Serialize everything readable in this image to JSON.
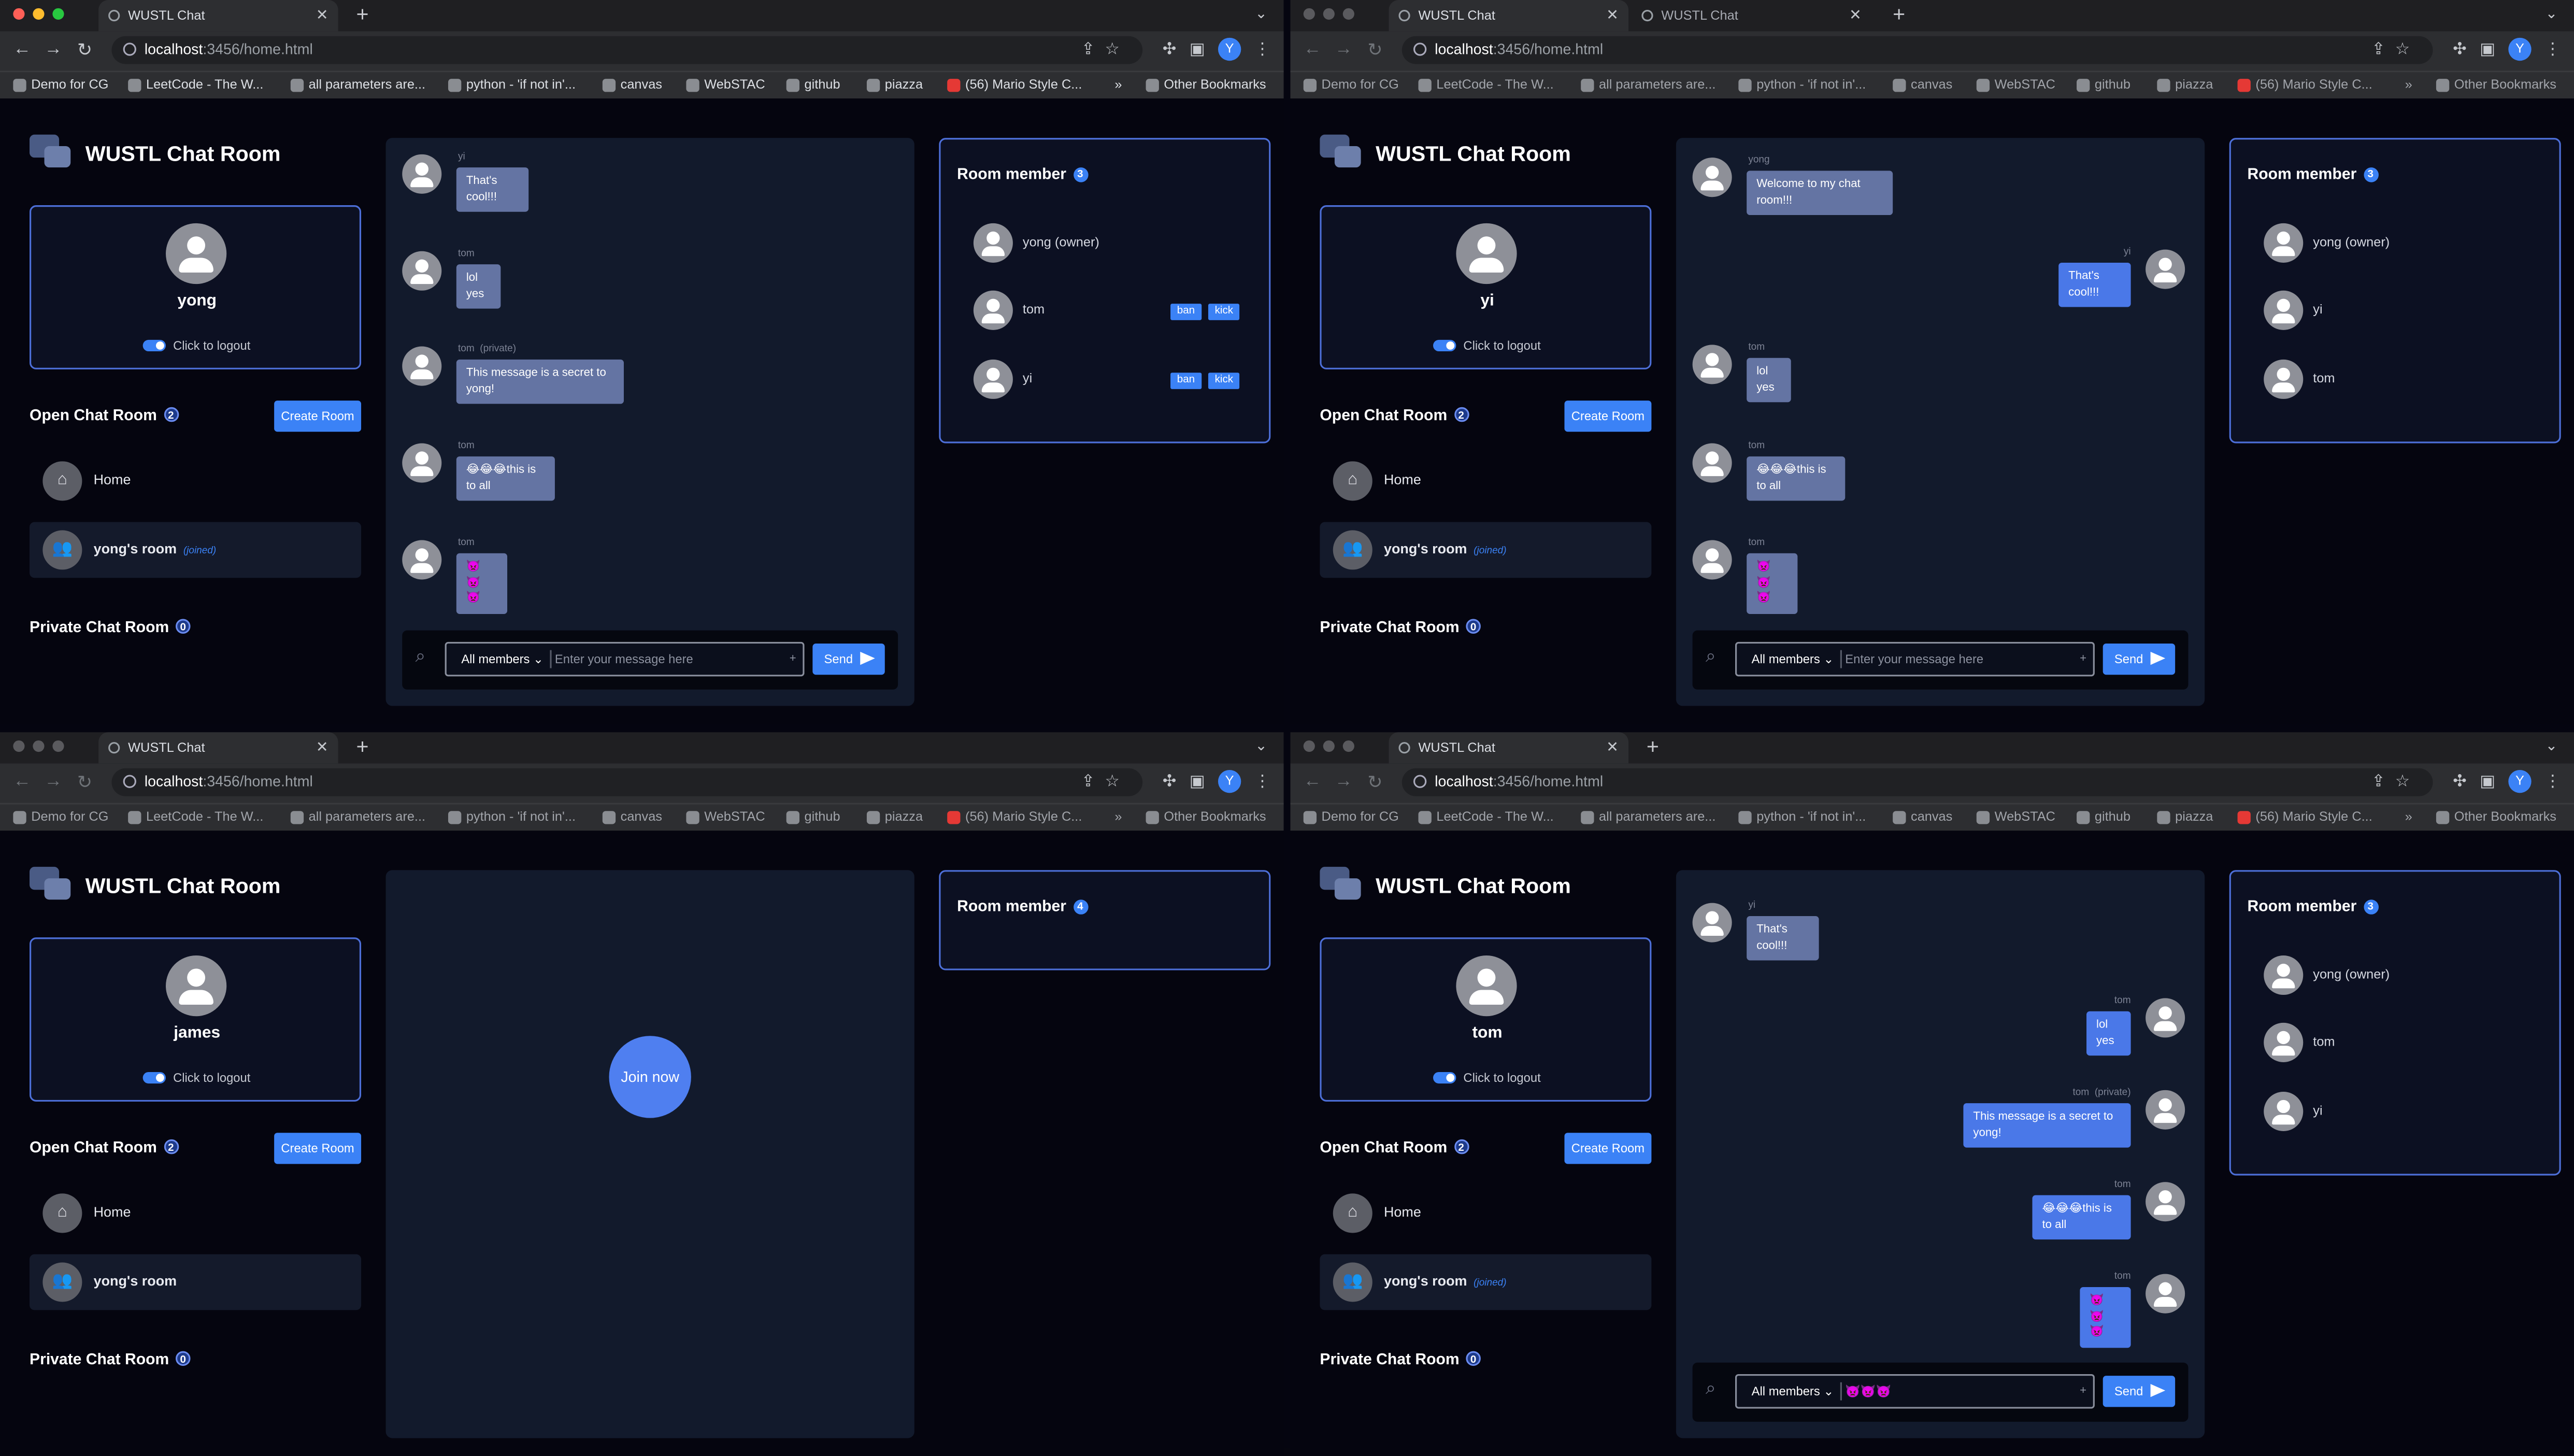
{
  "browser": {
    "tab_title": "WUSTL Chat",
    "url_host": "localhost",
    "url_path": ":3456/home.html",
    "profile_initial": "Y",
    "bookmarks": [
      "Demo for CG",
      "LeetCode - The W...",
      "all parameters are...",
      "python - 'if not in'...",
      "canvas",
      "WebSTAC",
      "github",
      "piazza",
      "(56) Mario Style C...",
      "Other Bookmarks"
    ],
    "bookmarks_more": "»"
  },
  "app": {
    "title": "WUSTL Chat Room",
    "logout_label": "Click to logout",
    "open_rooms_label": "Open Chat Room",
    "open_rooms_count": "2",
    "create_room_label": "Create Room",
    "private_rooms_label": "Private Chat Room",
    "private_rooms_count": "0",
    "rooms": [
      "Home",
      "yong's room"
    ],
    "joined_tag": "(joined)",
    "members_label": "Room member",
    "select_label": "All members",
    "placeholder": "Enter your message here",
    "send_label": "Send",
    "join_label": "Join now",
    "ban_label": "ban",
    "kick_label": "kick"
  },
  "windows": [
    {
      "user": "yong",
      "member_count": "3",
      "members": [
        "yong (owner)",
        "tom",
        "yi"
      ],
      "messages": [
        {
          "who": "yi",
          "text": "That's cool!!!"
        },
        {
          "who": "tom",
          "text": "lol yes"
        },
        {
          "who": "tom",
          "private": "(private)",
          "text": "This message is a secret to yong!"
        },
        {
          "who": "tom",
          "text": "😂😂😂this is to all"
        },
        {
          "who": "tom",
          "text": "👿👿👿"
        }
      ]
    },
    {
      "user": "yi",
      "member_count": "3",
      "members": [
        "yong (owner)",
        "yi",
        "tom"
      ],
      "messages": [
        {
          "who": "yong",
          "text": "Welcome to my chat room!!!"
        },
        {
          "who": "yi",
          "text": "That's cool!!!"
        },
        {
          "who": "tom",
          "text": "lol yes"
        },
        {
          "who": "tom",
          "text": "😂😂😂this is to all"
        },
        {
          "who": "tom",
          "text": "👿👿👿"
        }
      ]
    },
    {
      "user": "james",
      "member_count": "4",
      "members": []
    },
    {
      "user": "tom",
      "member_count": "3",
      "members": [
        "yong (owner)",
        "tom",
        "yi"
      ],
      "input_value": "👿👿👿",
      "messages": [
        {
          "who": "yi",
          "text": "That's cool!!!"
        },
        {
          "who": "tom",
          "text": "lol yes"
        },
        {
          "who": "tom",
          "private": "(private)",
          "text": "This message is a secret to yong!"
        },
        {
          "who": "tom",
          "text": "😂😂😂this is to all"
        },
        {
          "who": "tom",
          "text": "👿👿👿"
        }
      ]
    }
  ]
}
